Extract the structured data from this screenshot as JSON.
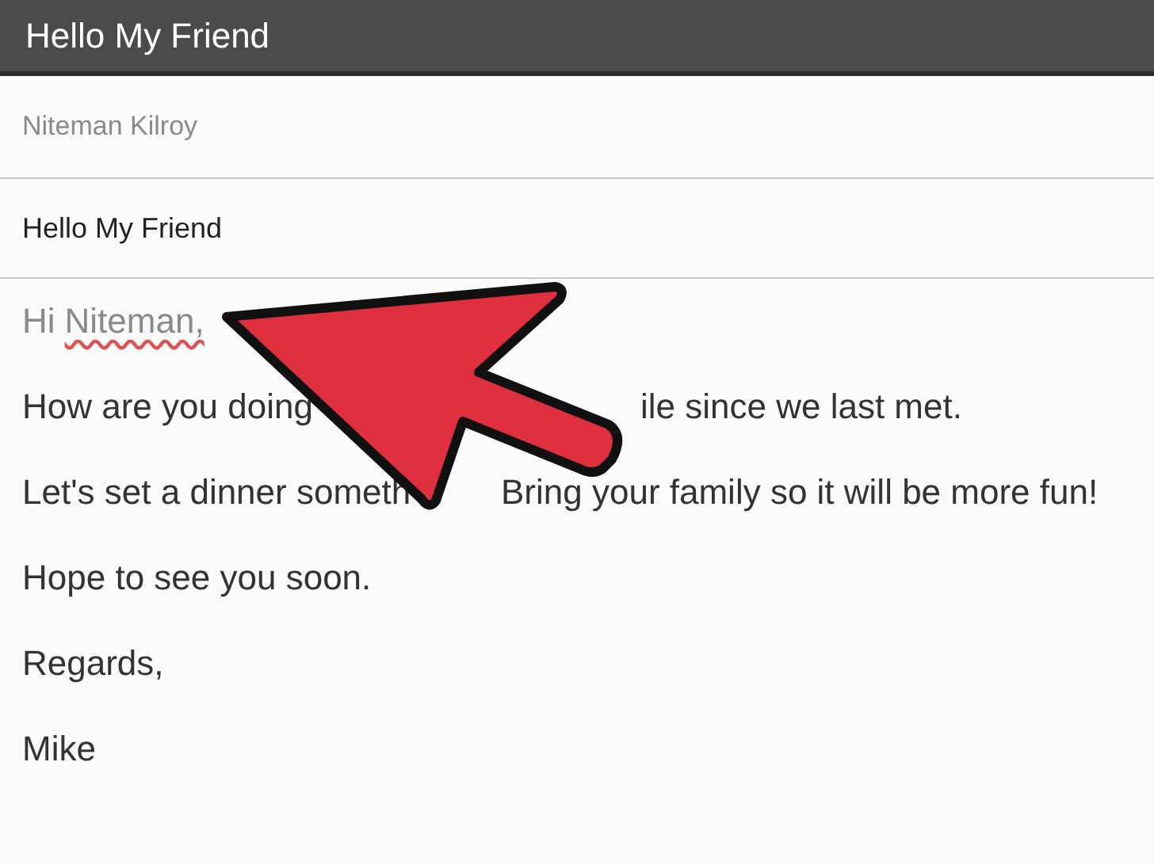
{
  "window": {
    "title": "Hello My Friend"
  },
  "to": {
    "value": "Niteman Kilroy"
  },
  "subject": {
    "value": "Hello My Friend"
  },
  "body": {
    "greeting": [
      {
        "text": "Hi",
        "misspelled": false
      },
      {
        "text": "Niteman,",
        "misspelled": true
      }
    ],
    "lines": [
      {
        "parts": [
          "How are you doing",
          "ile since we last met."
        ]
      },
      {
        "parts": [
          "Let's set a dinner someth",
          "Bring your family so it will be more fun!"
        ]
      },
      {
        "parts": [
          "Hope to see you soon."
        ]
      },
      {
        "parts": [
          "Regards,"
        ]
      },
      {
        "parts": [
          "Mike"
        ]
      }
    ]
  }
}
